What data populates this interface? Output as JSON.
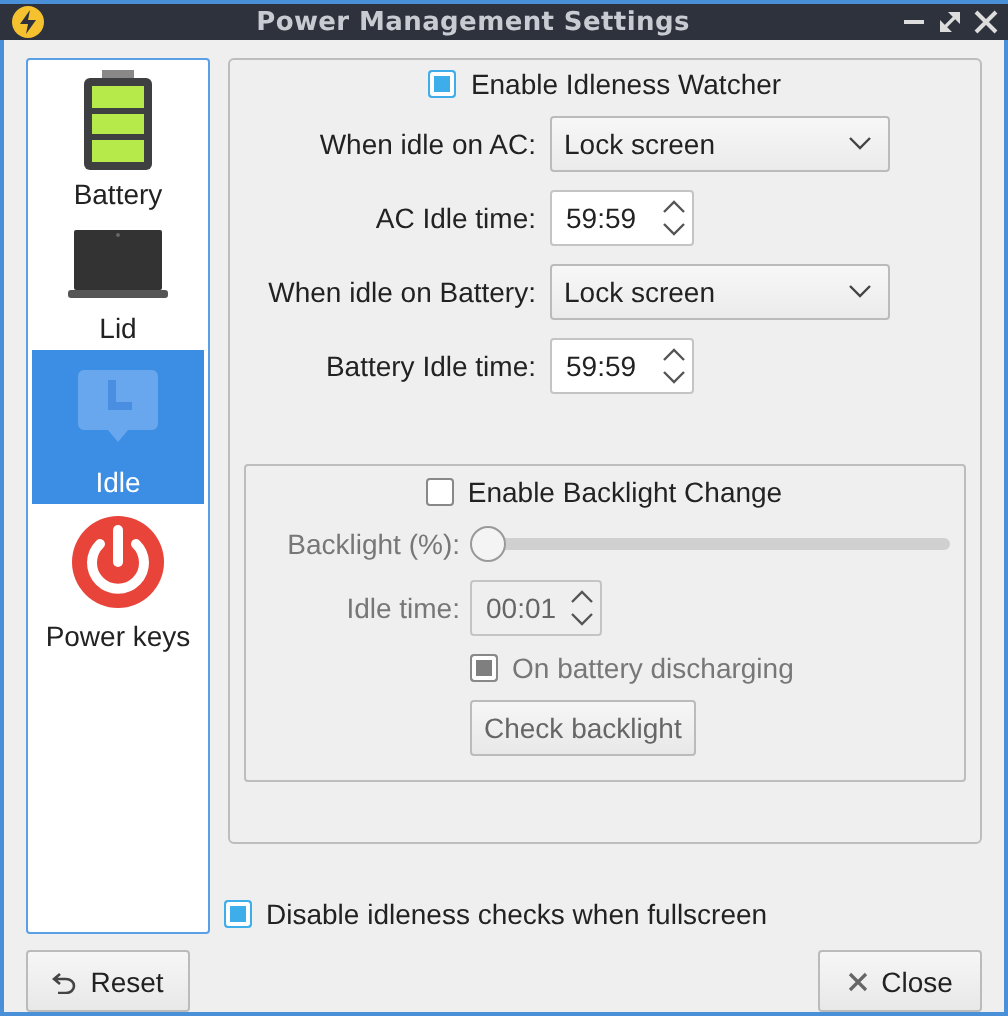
{
  "window": {
    "title": "Power Management Settings"
  },
  "sidebar": {
    "items": [
      {
        "label": "Battery",
        "kind": "battery",
        "selected": false
      },
      {
        "label": "Lid",
        "kind": "laptop",
        "selected": false
      },
      {
        "label": "Idle",
        "kind": "idle",
        "selected": true
      },
      {
        "label": "Power keys",
        "kind": "power",
        "selected": false
      }
    ]
  },
  "idleness_watcher": {
    "label": "Enable Idleness Watcher",
    "checked": true
  },
  "form": [
    {
      "kind": "combo",
      "label": "When idle on AC:",
      "value": "Lock screen"
    },
    {
      "kind": "spin",
      "label": "AC Idle time:",
      "value": "59:59"
    },
    {
      "kind": "combo",
      "label": "When idle on Battery:",
      "value": "Lock screen"
    },
    {
      "kind": "spin",
      "label": "Battery Idle time:",
      "value": "59:59"
    }
  ],
  "backlight": {
    "label": "Enable Backlight Change",
    "checked": false,
    "slider": {
      "label": "Backlight (%):",
      "level": 0
    },
    "idle_time": {
      "label": "Idle time:",
      "value": "00:01"
    },
    "on_battery": {
      "label": "On battery discharging",
      "checked": true
    },
    "button": "Check backlight"
  },
  "fullscreen": {
    "label": "Disable idleness checks when fullscreen",
    "checked": true
  },
  "buttons": [
    {
      "kind": "reset",
      "label": "Reset"
    },
    {
      "kind": "close",
      "label": "Close"
    }
  ]
}
